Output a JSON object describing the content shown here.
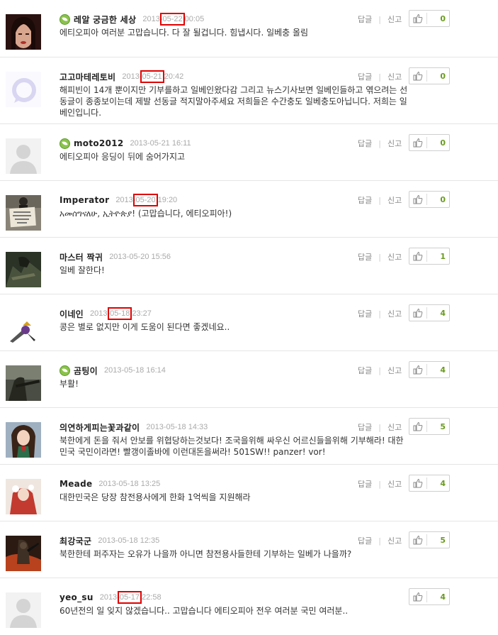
{
  "actions": {
    "reply_label": "답글",
    "report_label": "신고"
  },
  "comments": [
    {
      "nick": "레알 궁금한 세상",
      "badge": true,
      "date_pre": "2013-",
      "date_mark": "05-22",
      "date_post": " 00:05",
      "text": "에티오피아 여러분 고맙습니다. 다 잘 될겁니다. 힘냅시다. 일베충 올림",
      "votes": "0",
      "avatar": "woman-portrait"
    },
    {
      "nick": "고고마테레토비",
      "badge": false,
      "date_pre": "2013-",
      "date_mark": "05-21",
      "date_post": " 20:42",
      "text": "해피빈이 14개 뿐이지만 기부를하고 일베인왔다감 그리고 뉴스기사보면 일베인들하고 엮으려는 선동글이 종종보이는데 제발 선동글 적지말아주세요 저희들은 수간충도 일베충도아닙니다. 저희는 일베인입니다.",
      "votes": "0",
      "avatar": "speech-bubble"
    },
    {
      "nick": "moto2012",
      "badge": true,
      "date_pre": "2013-05-21 16:11",
      "date_mark": "",
      "date_post": "",
      "text": "에티오피아 응딩이 뒤에 숨어가지고",
      "votes": "0",
      "avatar": "default-person"
    },
    {
      "nick": "Imperator",
      "badge": false,
      "date_pre": "2013-",
      "date_mark": "05-20",
      "date_post": " 19:20",
      "text": "አመሰግናለሁ, ኢትዮጵያ! (고맙습니다, 에티오피아!)",
      "votes": "0",
      "avatar": "sign-person"
    },
    {
      "nick": "마스터 짝귀",
      "badge": false,
      "date_pre": "2013-05-20 15:56",
      "date_mark": "",
      "date_post": "",
      "text": "일베 잘한다!",
      "votes": "1",
      "avatar": "soldier-dark"
    },
    {
      "nick": "이네인",
      "badge": false,
      "date_pre": "2013-",
      "date_mark": "05-18",
      "date_post": " 23:27",
      "text": "콩은 별로 없지만 이게 도움이 된다면 좋겠네요..",
      "votes": "4",
      "avatar": "anime-small"
    },
    {
      "nick": "곰팅이",
      "badge": true,
      "date_pre": "2013-05-18 16:14",
      "date_mark": "",
      "date_post": "",
      "text": "부활!",
      "votes": "4",
      "avatar": "soldier-rifle"
    },
    {
      "nick": "의연하게피는꽃과같이",
      "badge": false,
      "date_pre": "2013-05-18 14:33",
      "date_mark": "",
      "date_post": "",
      "text": "북한에게 돈을 줘서 안보를 위협당하는것보다! 조국을위해 싸우신 어르신들을위해 기부해라! 대한민국 국민이라면! 빨갱이졸바에 이런대돈을써라! 501SW!! panzer! vor!",
      "votes": "5",
      "avatar": "anime-girl"
    },
    {
      "nick": "Meade",
      "badge": false,
      "date_pre": "2013-05-18 13:25",
      "date_mark": "",
      "date_post": "",
      "text": "대한민국은 당장 참전용사에게 한화 1억씩을 지원해라",
      "votes": "4",
      "avatar": "red-costume"
    },
    {
      "nick": "최강국군",
      "badge": false,
      "date_pre": "2013-05-18 12:35",
      "date_mark": "",
      "date_post": "",
      "text": "북한한테 퍼주자는 오유가 나을까 아니면 참전용사들한테 기부하는 일베가 나을까?",
      "votes": "5",
      "avatar": "fire-soldier"
    },
    {
      "nick": "yeo_su",
      "badge": false,
      "date_pre": "2013-",
      "date_mark": "05-17",
      "date_post": " 22:58",
      "text": "60년전의 일 잊지 않겠습니다.. 고맙습니다 에티오피아 전우 여러분 국민 여러분..",
      "votes": "4",
      "avatar": "default-person"
    }
  ]
}
